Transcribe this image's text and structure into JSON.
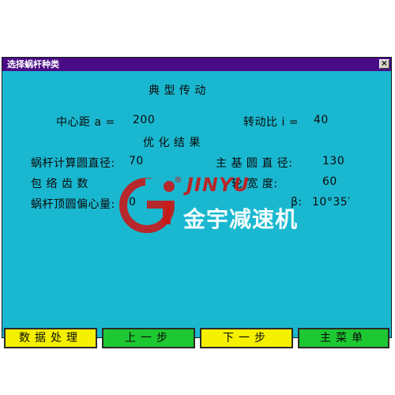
{
  "window": {
    "title": "选择蜗杆种类",
    "close_label": "×"
  },
  "content": {
    "heading": "典 型 传 动",
    "center_distance_label": "中心距 a =",
    "center_distance_value": "200",
    "ratio_label": "转动比 i =",
    "ratio_value": "40",
    "optimize_heading": "优 化 结 果",
    "worm_diameter_label": "蜗杆计算圆直径:",
    "worm_diameter_value": "70",
    "base_circle_label": "主 基 圆 直 径:",
    "base_circle_value": "130",
    "wrap_teeth_label": "包 络 齿 数",
    "wrap_teeth_value": "",
    "wheel_width_label": "轮 宽 度:",
    "wheel_width_value": "60",
    "worm_tip_offset_label": "蜗杆顶圆偏心量:",
    "worm_tip_offset_value": "0",
    "beta_label": "β:",
    "beta_value": "10°35′"
  },
  "logo": {
    "brand_en": "JINYU",
    "brand_cn": "金宇减速机",
    "reg_mark": "®",
    "colors": {
      "red": "#c81818",
      "white": "#ffffff"
    }
  },
  "buttons": {
    "data_process": "数据处理",
    "prev_step": "上一步",
    "next_step": "下一步",
    "main_menu": "主菜单"
  },
  "colors": {
    "background": "#1ab8d0",
    "titlebar": "#4a0c86",
    "button_yellow": "#f5f000",
    "button_green": "#1ec832"
  }
}
